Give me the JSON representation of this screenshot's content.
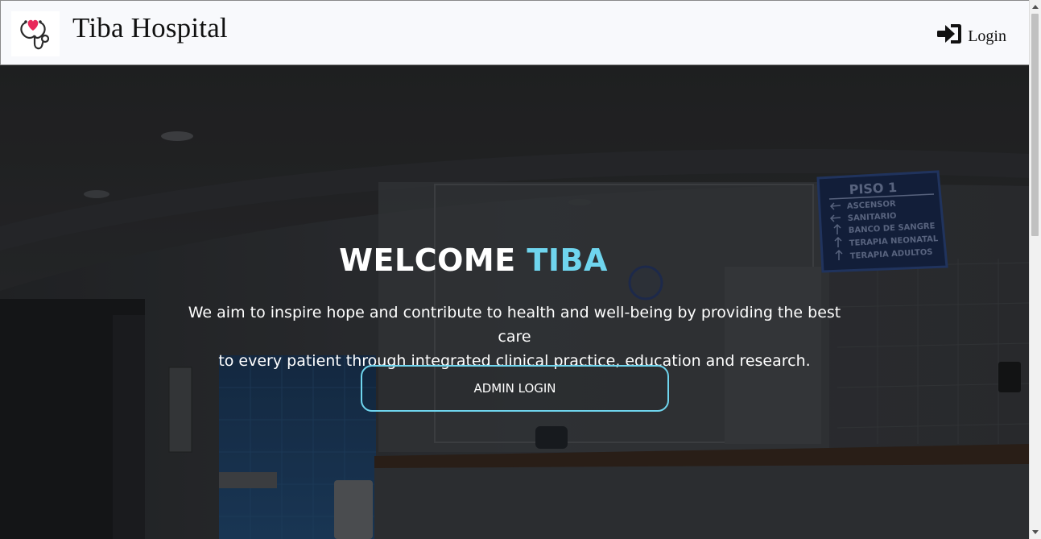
{
  "header": {
    "brand": "Tiba Hospital",
    "login_label": "Login"
  },
  "hero": {
    "title_prefix": "WELCOME",
    "title_accent": "TIBA",
    "line1": "We aim to inspire hope and contribute to health and well-being by providing the best care",
    "line2": "to every patient through integrated clinical practice, education and research.",
    "button_label": "ADMIN LOGIN",
    "sign": {
      "title": "PISO 1",
      "items": [
        "ASCENSOR",
        "SANITARIO",
        "BANCO DE SANGRE",
        "TERAPIA NEONATAL",
        "TERAPIA ADULTOS"
      ]
    }
  },
  "icons": {
    "logo": "stethoscope-heart-icon",
    "login": "sign-in-icon"
  },
  "colors": {
    "accent": "#6fd5ee",
    "navbar_bg": "#f8f9fc",
    "heart": "#e8285a"
  }
}
